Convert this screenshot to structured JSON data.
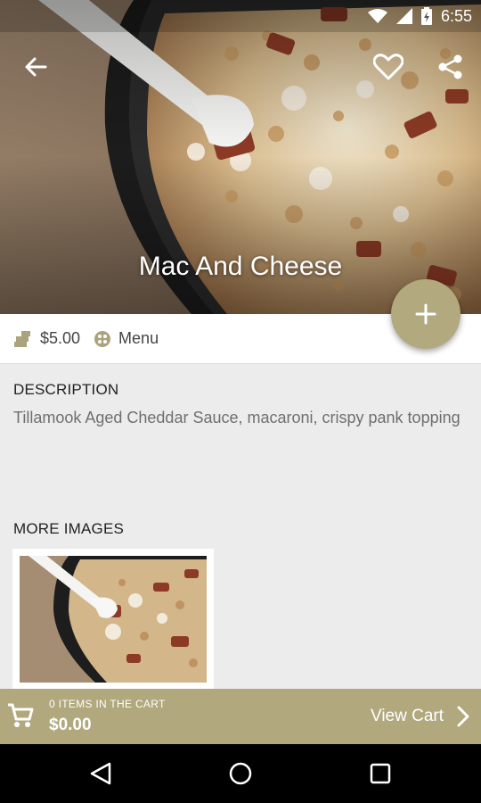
{
  "status_bar": {
    "time": "6:55"
  },
  "item": {
    "title": "Mac And Cheese",
    "price": "$5.00",
    "category": "Menu"
  },
  "description": {
    "heading": "DESCRIPTION",
    "text": "Tillamook Aged Cheddar Sauce, macaroni, crispy pank topping"
  },
  "more_images": {
    "heading": "MORE IMAGES"
  },
  "cart": {
    "count_label": "0 ITEMS IN THE CART",
    "total": "$0.00",
    "view_label": "View Cart"
  },
  "colors": {
    "accent": "#b1a87e",
    "nav": "#000000",
    "content_bg": "#ececec"
  },
  "icons": [
    "back-arrow-icon",
    "heart-icon",
    "share-icon",
    "plus-icon",
    "money-icon",
    "menu-category-icon",
    "cart-icon",
    "chevron-right-icon",
    "nav-back-icon",
    "nav-home-icon",
    "nav-recents-icon"
  ]
}
